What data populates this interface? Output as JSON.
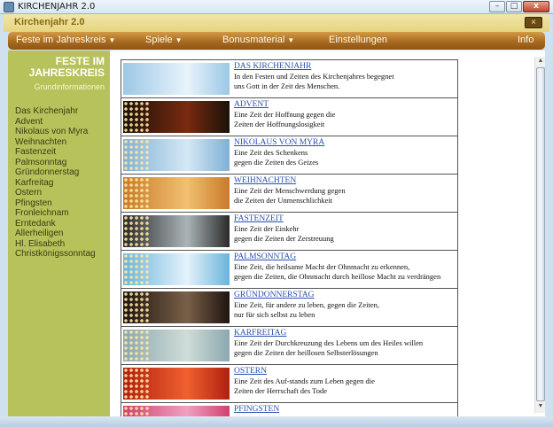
{
  "window": {
    "title": "KIRCHENJAHR 2.0",
    "min": "–",
    "max": "□",
    "close": "x"
  },
  "app": {
    "title": "Kirchenjahr 2.0",
    "close": "×"
  },
  "menu": [
    {
      "label": "Feste im Jahreskreis",
      "caret": "▼"
    },
    {
      "label": "Spiele",
      "caret": "▼"
    },
    {
      "label": "Bonusmaterial",
      "caret": "▼"
    },
    {
      "label": "Einstellungen",
      "caret": ""
    },
    {
      "label": "Info",
      "caret": ""
    }
  ],
  "sidebar": {
    "title_line1": "FESTE IM",
    "title_line2": "JAHRESKREIS",
    "subtitle": "Grundinformationen",
    "items": [
      "Das Kirchenjahr",
      "Advent",
      "Nikolaus von Myra",
      "Weihnachten",
      "Fastenzeit",
      "Palmsonntag",
      "Gründonnerstag",
      "Karfreitag",
      "Ostern",
      "Pfingsten",
      "Fronleichnam",
      "Erntedank",
      "Allerheiligen",
      "Hl. Elisabeth",
      "Christkönigssonntag"
    ]
  },
  "rows": [
    {
      "title": "DAS KIRCHENJAHR",
      "line1": "In den Festen und Zeiten des Kirchenjahres begegnet",
      "line2": "uns Gott in der Zeit des Menschen.",
      "bg": "#9cc8e6",
      "bg2": "#e8f3fb",
      "dots": false
    },
    {
      "title": "ADVENT",
      "line1": "Eine Zeit der Hoffnung gegen die",
      "line2": "Zeiten der Hoffnungslosigkeit",
      "bg": "#1a1208",
      "bg2": "#7a2a10",
      "dots": true
    },
    {
      "title": "NIKOLAUS VON MYRA",
      "line1": "Eine Zeit des Schenkens",
      "line2": "gegen die Zeiten des Geizes",
      "bg": "#7fb0d6",
      "bg2": "#d4e8f4",
      "dots": true
    },
    {
      "title": "WEIHNACHTEN",
      "line1": "Eine Zeit der Menschwerdung gegen",
      "line2": "die Zeiten der Unmenschlichkeit",
      "bg": "#c87a2a",
      "bg2": "#f0c070",
      "dots": true
    },
    {
      "title": "FASTENZEIT",
      "line1": "Eine Zeit der Einkehr",
      "line2": "gegen die Zeiten der Zerstreuung",
      "bg": "#2a2a2a",
      "bg2": "#aab4b8",
      "dots": true
    },
    {
      "title": "PALMSONNTAG",
      "line1": "Eine Zeit, die heilsame Macht der Ohnmacht zu erkennen,",
      "line2": "gegen die Zeiten, die Ohnmacht durch heillose Macht zu verdrängen",
      "bg": "#6ab4dc",
      "bg2": "#e4f2fa",
      "dots": true
    },
    {
      "title": "GRÜNDONNERSTAG",
      "line1": "Eine Zeit, für andere zu leben, gegen die Zeiten,",
      "line2": "nur für sich selbst zu leben",
      "bg": "#1e1410",
      "bg2": "#7a6048",
      "dots": true
    },
    {
      "title": "KARFREITAG",
      "line1": "Eine Zeit der Durchkreuzung des Lebens um des Heiles willen",
      "line2": "gegen die Zeiten der heillosen Selbsterlösungen",
      "bg": "#8aa8b0",
      "bg2": "#d0dcd8",
      "dots": true
    },
    {
      "title": "OSTERN",
      "line1": "Eine Zeit des Auf-stands zum Leben gegen die",
      "line2": "Zeiten  der Herrschaft des Tode",
      "bg": "#b02010",
      "bg2": "#f06030",
      "dots": true
    },
    {
      "title": "PFINGSTEN",
      "line1": "",
      "line2": "",
      "bg": "#d04070",
      "bg2": "#f0a0c0",
      "dots": true
    }
  ]
}
